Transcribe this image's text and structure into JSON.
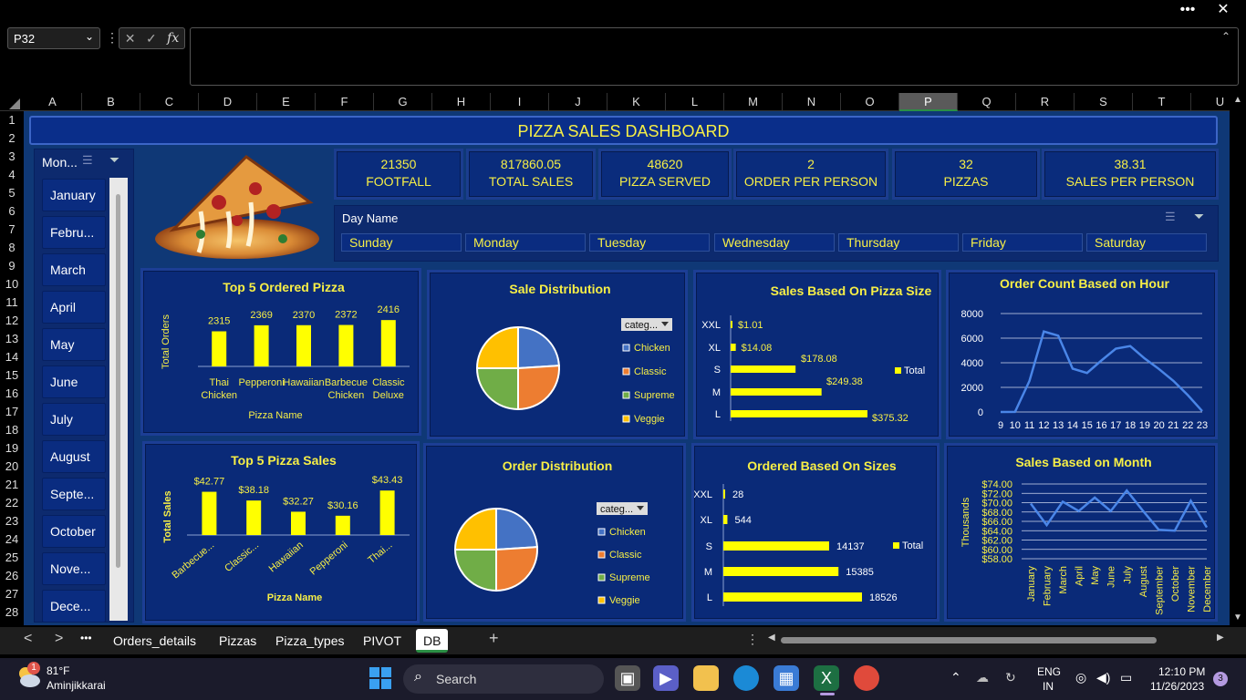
{
  "window": {
    "more_label": "•••",
    "close_label": "✕"
  },
  "formula_bar": {
    "name_box": "P32",
    "fx_label": "fx",
    "formula": ""
  },
  "columns": [
    "A",
    "B",
    "C",
    "D",
    "E",
    "F",
    "G",
    "H",
    "I",
    "J",
    "K",
    "L",
    "M",
    "N",
    "O",
    "P",
    "Q",
    "R",
    "S",
    "T",
    "U"
  ],
  "selected_column": "P",
  "rows": [
    "1",
    "2",
    "3",
    "4",
    "5",
    "6",
    "7",
    "8",
    "9",
    "10",
    "11",
    "12",
    "13",
    "14",
    "15",
    "16",
    "17",
    "18",
    "19",
    "20",
    "21",
    "22",
    "23",
    "24",
    "25",
    "26",
    "27",
    "28"
  ],
  "dashboard": {
    "title": "PIZZA SALES DASHBOARD",
    "month_slicer": {
      "title": "Mon...",
      "items": [
        "January",
        "Febru...",
        "March",
        "April",
        "May",
        "June",
        "July",
        "August",
        "Septe...",
        "October",
        "Nove...",
        "Dece..."
      ]
    },
    "kpis": [
      {
        "value": "21350",
        "label": "FOOTFALL"
      },
      {
        "value": "817860.05",
        "label": "TOTAL SALES"
      },
      {
        "value": "48620",
        "label": "PIZZA SERVED"
      },
      {
        "value": "2",
        "label": "ORDER PER PERSON"
      },
      {
        "value": "32",
        "label": "PIZZAS"
      },
      {
        "value": "38.31",
        "label": "SALES PER PERSON"
      }
    ],
    "day_slicer": {
      "title": "Day Name",
      "items": [
        "Sunday",
        "Monday",
        "Tuesday",
        "Wednesday",
        "Thursday",
        "Friday",
        "Saturday"
      ]
    },
    "colors": {
      "accent": "#f7ef46",
      "bar": "#ffff00",
      "line": "#4a86e8",
      "pie": [
        "#4472c4",
        "#ed7d31",
        "#70ad47",
        "#ffc000"
      ]
    }
  },
  "chart_data": [
    {
      "type": "bar",
      "title": "Top 5 Ordered Pizza",
      "xlabel": "Pizza Name",
      "ylabel": "Total Orders",
      "categories": [
        "Thai Chicken",
        "Pepperoni",
        "Hawaiian",
        "Barbecue Chicken",
        "Classic Deluxe"
      ],
      "category_lines": [
        [
          "Thai",
          "Chicken"
        ],
        [
          "Pepperoni"
        ],
        [
          "Hawaiian"
        ],
        [
          "Barbecue",
          "Chicken"
        ],
        [
          "Classic",
          "Deluxe"
        ]
      ],
      "values": [
        2315,
        2369,
        2370,
        2372,
        2416
      ],
      "labels": [
        "2315",
        "2369",
        "2370",
        "2372",
        "2416"
      ]
    },
    {
      "type": "pie",
      "title": "Sale Distribution",
      "filter": "categ...",
      "legend": [
        "Chicken",
        "Classic",
        "Supreme",
        "Veggie"
      ],
      "values": [
        24,
        26,
        25,
        25
      ]
    },
    {
      "type": "bar",
      "orientation": "horizontal",
      "title": "Sales Based On Pizza Size",
      "legend": [
        "Total"
      ],
      "categories": [
        "XXL",
        "XL",
        "S",
        "M",
        "L"
      ],
      "values": [
        1.01,
        14.08,
        178.08,
        249.38,
        375.32
      ],
      "labels": [
        "$1.01",
        "$14.08",
        "$178.08",
        "$249.38",
        "$375.32"
      ]
    },
    {
      "type": "line",
      "title": "Order Count Based on Hour",
      "x": [
        9,
        10,
        11,
        12,
        13,
        14,
        15,
        16,
        17,
        18,
        19,
        20,
        21,
        22,
        23
      ],
      "values": [
        1,
        8,
        2520,
        6543,
        6203,
        3521,
        3170,
        4185,
        5143,
        5359,
        4350,
        3487,
        2528,
        1370,
        68
      ],
      "yticks": [
        "8000",
        "6000",
        "4000",
        "2000",
        "0"
      ],
      "ylim": [
        0,
        8000
      ]
    },
    {
      "type": "bar",
      "title": "Top 5 Pizza Sales",
      "xlabel": "Pizza Name",
      "ylabel": "Total Sales",
      "categories": [
        "Barbecue...",
        "Classic...",
        "Hawaiian",
        "Pepperoni",
        "Thai..."
      ],
      "values": [
        42.77,
        38.18,
        32.27,
        30.16,
        43.43
      ],
      "labels": [
        "$42.77",
        "$38.18",
        "$32.27",
        "$30.16",
        "$43.43"
      ]
    },
    {
      "type": "pie",
      "title": "Order Distribution",
      "filter": "categ...",
      "legend": [
        "Chicken",
        "Classic",
        "Supreme",
        "Veggie"
      ],
      "values": [
        24,
        26,
        25,
        25
      ]
    },
    {
      "type": "bar",
      "orientation": "horizontal",
      "title": "Ordered Based On Sizes",
      "legend": [
        "Total"
      ],
      "categories": [
        "XXL",
        "XL",
        "S",
        "M",
        "L"
      ],
      "values": [
        28,
        544,
        14137,
        15385,
        18526
      ],
      "labels": [
        "28",
        "544",
        "14137",
        "15385",
        "18526"
      ]
    },
    {
      "type": "line",
      "title": "Sales Based on Month",
      "ylabel": "Thousands",
      "categories": [
        "January",
        "February",
        "March",
        "April",
        "May",
        "June",
        "July",
        "August",
        "September",
        "October",
        "November",
        "December"
      ],
      "values": [
        69.8,
        65.2,
        70.2,
        68.2,
        71.1,
        68.2,
        72.6,
        68.3,
        64.2,
        64.0,
        70.4,
        64.7
      ],
      "yticks": [
        "$74.00",
        "$72.00",
        "$70.00",
        "$68.00",
        "$66.00",
        "$64.00",
        "$62.00",
        "$60.00",
        "$58.00"
      ],
      "ylim": [
        58,
        74
      ]
    }
  ],
  "sheet_tabs": {
    "nav_prev": "<",
    "nav_next": ">",
    "more": "•••",
    "tabs": [
      "Orders_details",
      "Pizzas",
      "Pizza_types",
      "PIVOT",
      "DB"
    ],
    "active": "DB",
    "add": "+"
  },
  "taskbar": {
    "weather_temp": "81°F",
    "weather_loc": "Aminjikkarai",
    "weather_badge": "1",
    "search_label": "Search",
    "lang_top": "ENG",
    "lang_bottom": "IN",
    "time": "12:10 PM",
    "date": "11/26/2023",
    "notif_count": "3"
  }
}
